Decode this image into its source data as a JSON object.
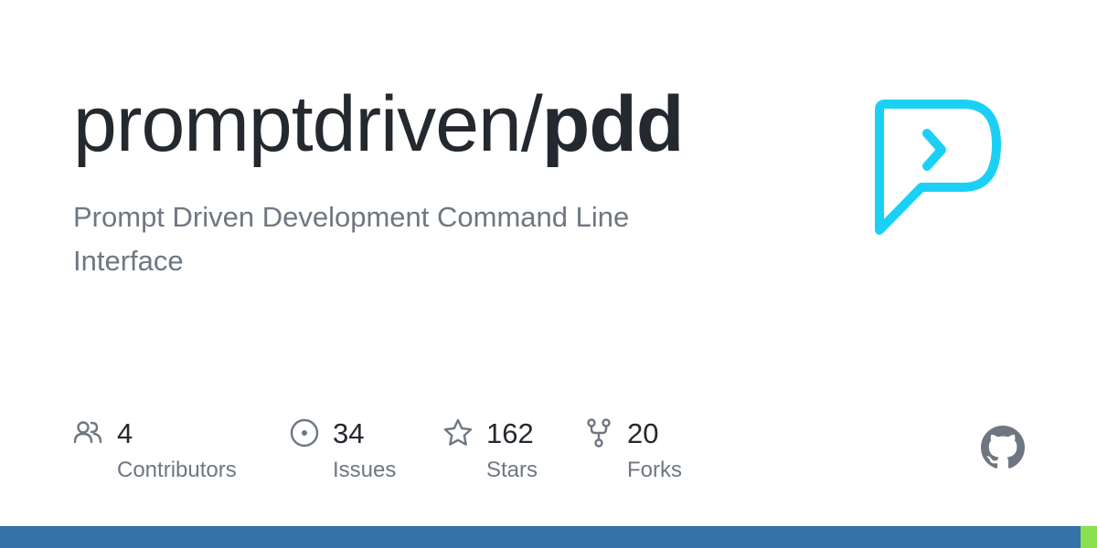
{
  "repo": {
    "owner": "promptdriven/",
    "name": "pdd",
    "description": "Prompt Driven Development Command Line Interface"
  },
  "logo": {
    "icon": "prompt-p-logo-icon",
    "color": "#1ad1f5"
  },
  "stats": [
    {
      "value": "4",
      "label": "Contributors",
      "icon": "people-icon"
    },
    {
      "value": "34",
      "label": "Issues",
      "icon": "issue-opened-icon"
    },
    {
      "value": "162",
      "label": "Stars",
      "icon": "star-icon"
    },
    {
      "value": "20",
      "label": "Forks",
      "icon": "repo-forked-icon"
    }
  ],
  "github_mark": {
    "icon": "github-mark-icon",
    "color": "#6e7781"
  },
  "language_bar": {
    "segments": [
      {
        "color": "#3572a5",
        "fraction": 0.985
      },
      {
        "color": "#89e051",
        "fraction": 0.015
      }
    ]
  },
  "colors": {
    "title": "#24292f",
    "muted": "#6e7781",
    "accent": "#1ad1f5"
  }
}
